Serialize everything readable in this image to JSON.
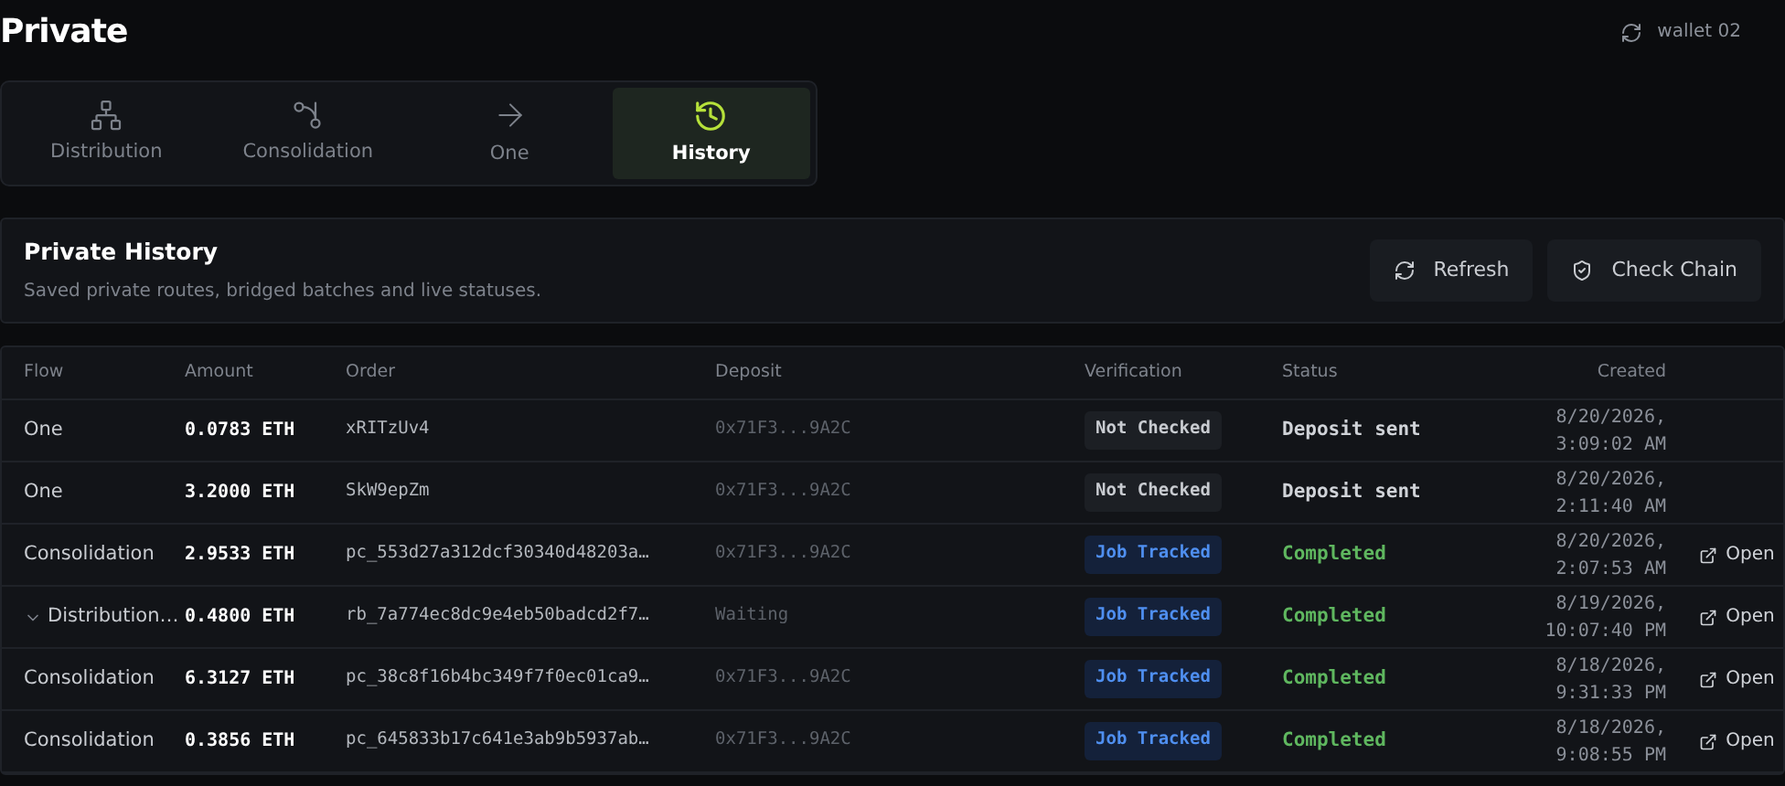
{
  "page": {
    "title": "Private",
    "wallet": "wallet 02"
  },
  "tabs": [
    {
      "label": "Distribution",
      "kind": "distribution",
      "selected": false
    },
    {
      "label": "Consolidation",
      "kind": "consolidation",
      "selected": false
    },
    {
      "label": "One",
      "kind": "one",
      "selected": false
    },
    {
      "label": "History",
      "kind": "history",
      "selected": true
    }
  ],
  "history": {
    "title": "Private History",
    "subtitle": "Saved private routes, bridged batches and live statuses.",
    "buttons": [
      {
        "label": "Refresh",
        "kind": "refresh"
      },
      {
        "label": "Check Chain",
        "kind": "check"
      }
    ]
  },
  "table": {
    "columns": [
      "Flow",
      "Amount",
      "Order",
      "Deposit",
      "Verification",
      "Status",
      "Created"
    ],
    "rows": [
      {
        "flow": "One",
        "has_children": false,
        "amount": "0.0783 ETH",
        "order": "xRITzUv4",
        "deposit": "0x71F3...9A2C",
        "verification": {
          "label": "Not Checked",
          "kind": "not_checked"
        },
        "status": {
          "label": "Deposit sent",
          "kind": "sent"
        },
        "created": "8/20/2026, 3:09:02 AM"
      },
      {
        "flow": "One",
        "has_children": false,
        "amount": "3.2000 ETH",
        "order": "SkW9epZm",
        "deposit": "0x71F3...9A2C",
        "verification": {
          "label": "Not Checked",
          "kind": "not_checked"
        },
        "status": {
          "label": "Deposit sent",
          "kind": "sent"
        },
        "created": "8/20/2026, 2:11:40 AM"
      },
      {
        "flow": "Consolidation",
        "has_children": false,
        "amount": "2.9533 ETH",
        "order": "pc_553d27a312dcf30340d48203a…",
        "deposit": "0x71F3...9A2C",
        "verification": {
          "label": "Job Tracked",
          "kind": "tracked"
        },
        "status": {
          "label": "Completed",
          "kind": "completed"
        },
        "created": "8/20/2026, 2:07:53 AM",
        "action": "Open"
      },
      {
        "flow": "Distribution…",
        "has_children": true,
        "amount": "0.4800 ETH",
        "order": "rb_7a774ec8dc9e4eb50badcd2f7…",
        "deposit": "Waiting",
        "verification": {
          "label": "Job Tracked",
          "kind": "tracked"
        },
        "status": {
          "label": "Completed",
          "kind": "completed"
        },
        "created": "8/19/2026, 10:07:40 PM",
        "action": "Open"
      },
      {
        "flow": "Consolidation",
        "has_children": false,
        "amount": "6.3127 ETH",
        "order": "pc_38c8f16b4bc349f7f0ec01ca9…",
        "deposit": "0x71F3...9A2C",
        "verification": {
          "label": "Job Tracked",
          "kind": "tracked"
        },
        "status": {
          "label": "Completed",
          "kind": "completed"
        },
        "created": "8/18/2026, 9:31:33 PM",
        "action": "Open"
      },
      {
        "flow": "Consolidation",
        "has_children": false,
        "amount": "0.3856 ETH",
        "order": "pc_645833b17c641e3ab9b5937ab…",
        "deposit": "0x71F3...9A2C",
        "verification": {
          "label": "Job Tracked",
          "kind": "tracked"
        },
        "status": {
          "label": "Completed",
          "kind": "completed"
        },
        "created": "8/18/2026, 9:08:55 PM",
        "action": "Open"
      }
    ]
  }
}
